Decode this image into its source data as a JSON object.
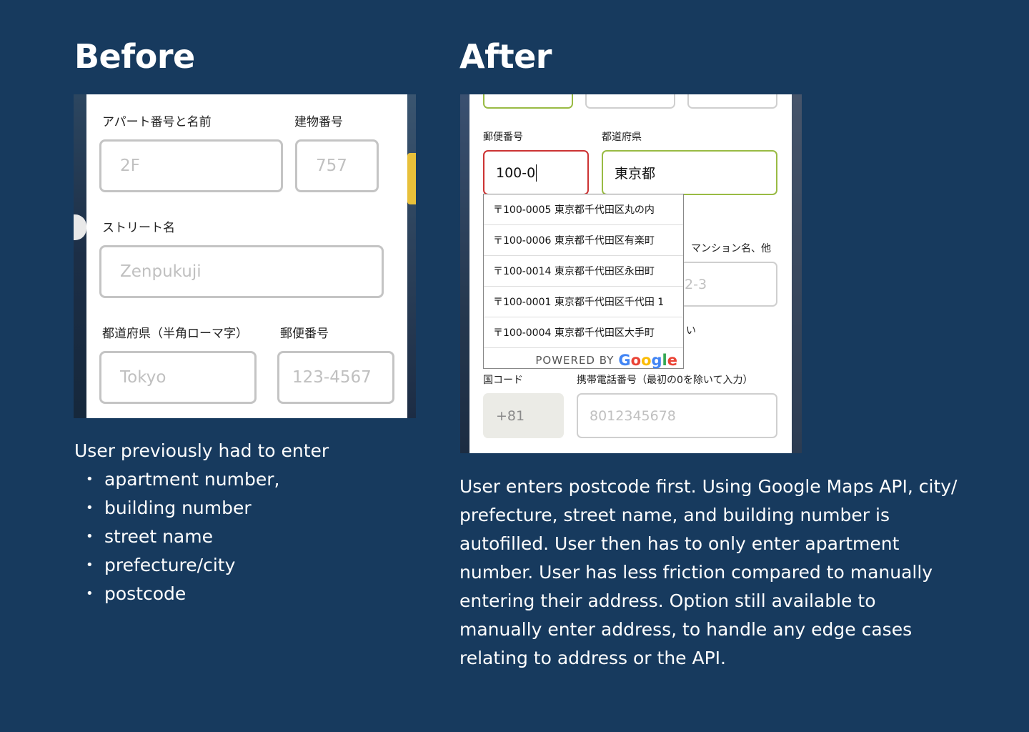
{
  "before": {
    "heading": "Before",
    "form": {
      "apartment_label": "アパート番号と名前",
      "building_label": "建物番号",
      "apartment_placeholder": "2F",
      "building_placeholder": "757",
      "street_label": "ストリート名",
      "street_placeholder": "Zenpukuji",
      "prefecture_label": "都道府県（半角ローマ字）",
      "postcode_label": "郵便番号",
      "prefecture_placeholder": "Tokyo",
      "postcode_placeholder": "123-4567"
    },
    "caption_intro": "User previously had to enter",
    "items": [
      "apartment number,",
      "building number",
      "street name",
      "prefecture/city",
      "postcode"
    ]
  },
  "after": {
    "heading": "After",
    "form": {
      "postcode_label": "郵便番号",
      "prefecture_label": "都道府県",
      "postcode_value": "100-0",
      "prefecture_value": "東京都",
      "mansion_label": "マンション名、他",
      "hidden_field_value": "2-3",
      "partial_text": "い",
      "country_code_label": "国コード",
      "phone_label": "携帯電話番号（最初の0を除いて入力）",
      "country_code_value": "+81",
      "phone_placeholder": "8012345678"
    },
    "suggestions": [
      "〒100-0005 東京都千代田区丸の内",
      "〒100-0006 東京都千代田区有楽町",
      "〒100-0014 東京都千代田区永田町",
      "〒100-0001 東京都千代田区千代田 1",
      "〒100-0004 東京都千代田区大手町"
    ],
    "powered_by": "POWERED BY",
    "google_letters": [
      "G",
      "o",
      "o",
      "g",
      "l",
      "e"
    ],
    "google_colors": [
      "#4285F4",
      "#EA4335",
      "#FBBC05",
      "#4285F4",
      "#34A853",
      "#EA4335"
    ],
    "caption": "User enters postcode first. Using Google Maps API, city/ prefecture, street name, and building number is autofilled. User then has to only enter apartment number. User has less friction compared to manually entering their  address. Option still available to manually enter address, to handle any edge cases relating to address or the API."
  },
  "colors": {
    "background": "#173a5e",
    "field_error_border": "#cc3333",
    "field_valid_border": "#99bb44"
  }
}
